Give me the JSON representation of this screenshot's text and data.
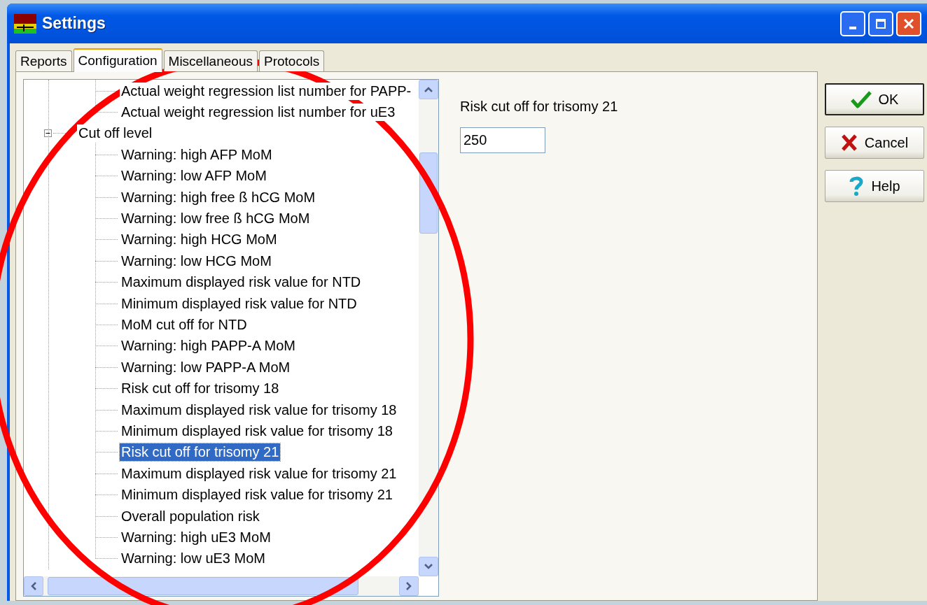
{
  "window": {
    "title": "Settings"
  },
  "tabs": [
    {
      "label": "Reports",
      "selected": false
    },
    {
      "label": "Configuration",
      "selected": true
    },
    {
      "label": "Miscellaneous",
      "selected": false
    },
    {
      "label": "Protocols",
      "selected": false
    }
  ],
  "tree": {
    "items": [
      {
        "expanded": true,
        "children": [
          {
            "label": "Actual weight regression list number for PAPP-",
            "selected": false
          },
          {
            "label": "Actual weight regression list number for uE3",
            "selected": false
          }
        ]
      },
      {
        "label": "Cut off level",
        "expanded": true,
        "children": [
          {
            "label": "Warning: high AFP MoM",
            "selected": false
          },
          {
            "label": "Warning: low AFP MoM",
            "selected": false
          },
          {
            "label": "Warning: high free ß hCG MoM",
            "selected": false
          },
          {
            "label": "Warning: low free ß hCG MoM",
            "selected": false
          },
          {
            "label": "Warning: high HCG MoM",
            "selected": false
          },
          {
            "label": "Warning: low HCG MoM",
            "selected": false
          },
          {
            "label": "Maximum displayed risk value for NTD",
            "selected": false
          },
          {
            "label": "Minimum displayed risk value for NTD",
            "selected": false
          },
          {
            "label": "MoM cut off for NTD",
            "selected": false
          },
          {
            "label": "Warning: high PAPP-A MoM",
            "selected": false
          },
          {
            "label": "Warning: low PAPP-A MoM",
            "selected": false
          },
          {
            "label": "Risk cut off for trisomy 18",
            "selected": false
          },
          {
            "label": "Maximum displayed risk value for trisomy 18",
            "selected": false
          },
          {
            "label": "Minimum displayed risk value for trisomy 18",
            "selected": false
          },
          {
            "label": "Risk cut off for trisomy 21",
            "selected": true
          },
          {
            "label": "Maximum displayed risk value for trisomy 21",
            "selected": false
          },
          {
            "label": "Minimum displayed risk value for trisomy 21",
            "selected": false
          },
          {
            "label": "Overall population risk",
            "selected": false
          },
          {
            "label": "Warning: high uE3 MoM",
            "selected": false
          },
          {
            "label": "Warning: low uE3 MoM",
            "selected": false
          }
        ]
      }
    ]
  },
  "detail": {
    "label": "Risk cut off for trisomy 21",
    "value": "250"
  },
  "buttons": [
    {
      "kind": "ok",
      "label": "OK"
    },
    {
      "kind": "cancel",
      "label": "Cancel"
    },
    {
      "kind": "help",
      "label": "Help"
    }
  ]
}
